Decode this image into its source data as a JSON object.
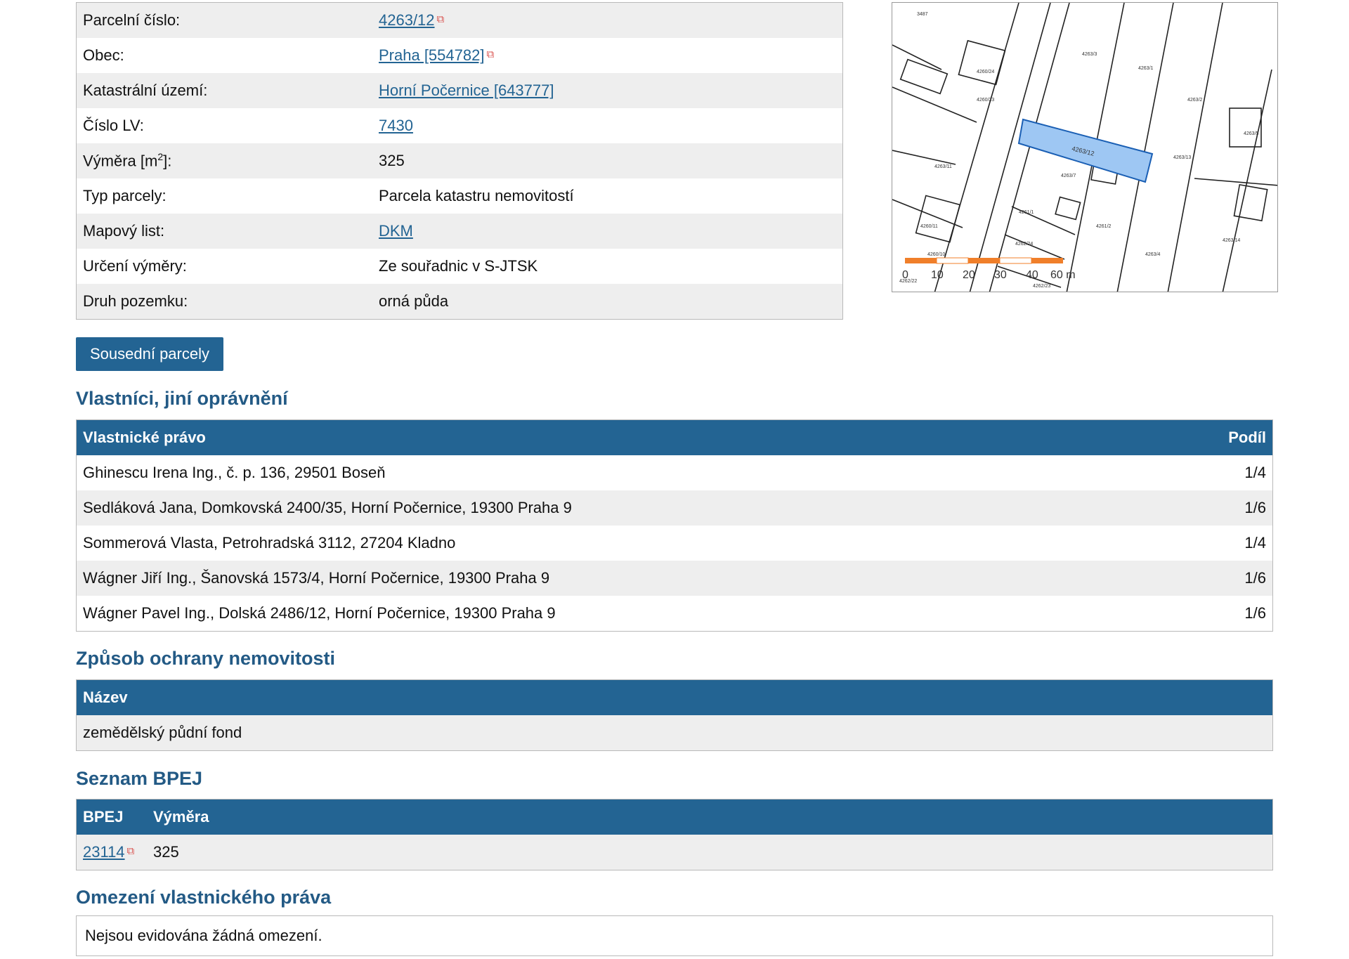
{
  "parcel": {
    "rows": [
      {
        "label": "Parcelní číslo:",
        "value": "4263/12",
        "link": true,
        "ext": true
      },
      {
        "label": "Obec:",
        "value": "Praha [554782]",
        "link": true,
        "ext": true
      },
      {
        "label": "Katastrální území:",
        "value": "Horní Počernice [643777]",
        "link": true,
        "ext": false
      },
      {
        "label": "Číslo LV:",
        "value": "7430",
        "link": true,
        "ext": false
      },
      {
        "label": "Výměra [m2]:",
        "value": "325",
        "link": false,
        "ext": false
      },
      {
        "label": "Typ parcely:",
        "value": "Parcela katastru nemovitostí",
        "link": false,
        "ext": false
      },
      {
        "label": "Mapový list:",
        "value": "DKM",
        "link": true,
        "ext": false
      },
      {
        "label": "Určení výměry:",
        "value": "Ze souřadnic v S-JTSK",
        "link": false,
        "ext": false
      },
      {
        "label": "Druh pozemku:",
        "value": "orná půda",
        "link": false,
        "ext": false
      }
    ]
  },
  "map": {
    "highlight_label": "4263/12",
    "scale_labels": [
      "0",
      "10",
      "20",
      "30",
      "40",
      "60 m"
    ],
    "labels": [
      "3487",
      "4260/24",
      "4260/23",
      "4263/3",
      "4263/1",
      "4263/2",
      "4263/13",
      "4263/11",
      "4263/7",
      "4261/2",
      "4263/14",
      "4260/11",
      "4260/10",
      "4261/1",
      "4262/24",
      "4263/4",
      "4263/5",
      "4262/22",
      "4262/23"
    ]
  },
  "buttons": {
    "neighbors": "Sousední parcely"
  },
  "owners": {
    "title": "Vlastníci, jiní oprávnění",
    "header_left": "Vlastnické právo",
    "header_right": "Podíl",
    "rows": [
      {
        "name": "Ghinescu Irena Ing., č. p. 136, 29501 Boseň",
        "share": "1/4"
      },
      {
        "name": "Sedláková Jana, Domkovská 2400/35, Horní Počernice, 19300 Praha 9",
        "share": "1/6"
      },
      {
        "name": "Sommerová Vlasta, Petrohradská 3112, 27204 Kladno",
        "share": "1/4"
      },
      {
        "name": "Wágner Jiří Ing., Šanovská 1573/4, Horní Počernice, 19300 Praha 9",
        "share": "1/6"
      },
      {
        "name": "Wágner Pavel Ing., Dolská 2486/12, Horní Počernice, 19300 Praha 9",
        "share": "1/6"
      }
    ]
  },
  "protection": {
    "title": "Způsob ochrany nemovitosti",
    "header": "Název",
    "value": "zemědělský půdní fond"
  },
  "bpej": {
    "title": "Seznam BPEJ",
    "header_code": "BPEJ",
    "header_area": "Výměra",
    "code": "23114",
    "area": "325"
  },
  "restrictions": {
    "title": "Omezení vlastnického práva",
    "text": "Nejsou evidována žádná omezení."
  },
  "colors": {
    "accent": "#236493",
    "title": "#235a85",
    "link": "#236493",
    "highlight": "#9ec7f3",
    "scale_orange": "#f07f2a"
  }
}
